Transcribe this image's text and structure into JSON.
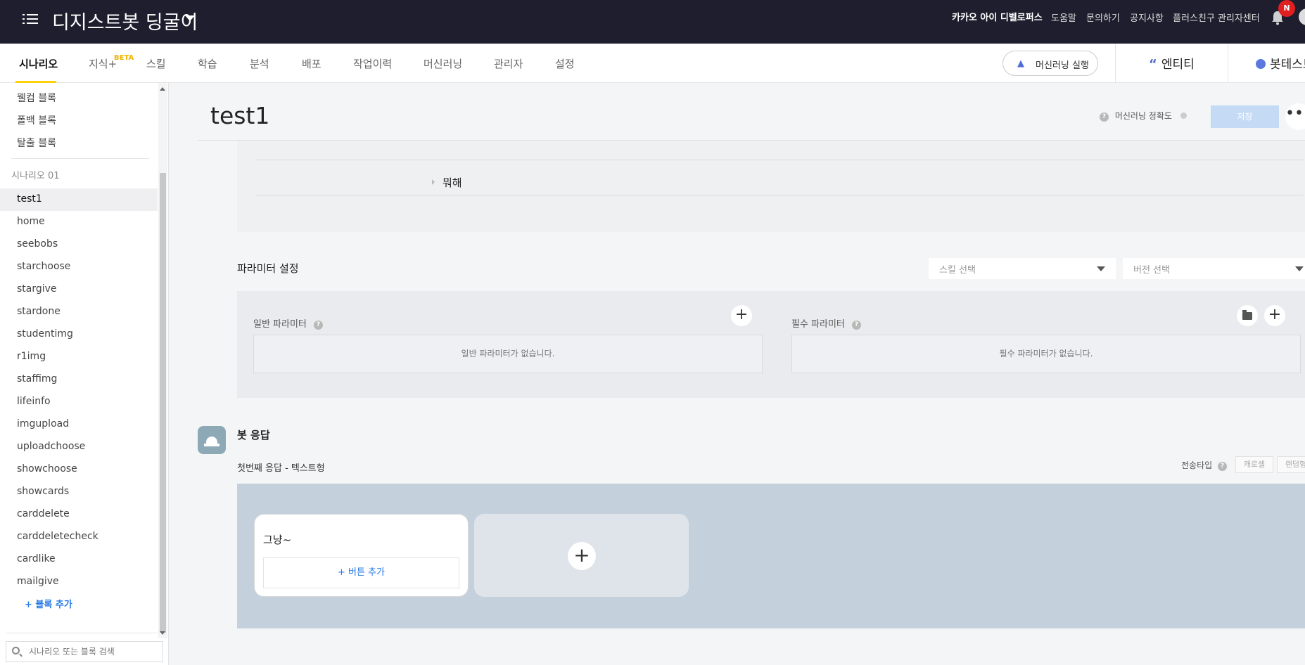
{
  "topbar": {
    "bot_name": "디지스트봇 딩굴이",
    "links": [
      "도움말",
      "문의하기",
      "공지사항",
      "플러스친구 관리자센터"
    ],
    "developers": "카카오 아이 디벨로퍼스",
    "notif_badge": "N"
  },
  "nav": {
    "tabs": [
      "시나리오",
      "지식+",
      "스킬",
      "학습",
      "분석",
      "배포",
      "작업이력",
      "머신러닝",
      "관리자",
      "설정"
    ],
    "beta": "BETA",
    "ml_run": "머신러닝 실행",
    "entity": "엔티티",
    "bot_test": "봇테스트"
  },
  "sidebar": {
    "system_blocks": [
      "웰컴 블록",
      "폴백 블록",
      "탈출 블록"
    ],
    "section": "시나리오 01",
    "blocks": [
      "test1",
      "home",
      "seebobs",
      "starchoose",
      "stargive",
      "stardone",
      "studentimg",
      "r1img",
      "staffimg",
      "lifeinfo",
      "imgupload",
      "uploadchoose",
      "showchoose",
      "showcards",
      "carddelete",
      "carddeletecheck",
      "cardlike",
      "mailgive"
    ],
    "add_block": "+ 블록 추가",
    "search_placeholder": "시나리오 또는 블록 검색"
  },
  "main": {
    "title": "test1",
    "ml_accuracy": "머신러닝 정확도",
    "save": "저장",
    "more": "•••",
    "utterance": "뭐해",
    "param_title": "파라미터 설정",
    "skill_select": "스킬 선택",
    "version_select": "버전 선택",
    "general_param": "일반 파라미터",
    "general_empty": "일반 파라미터가 없습니다.",
    "required_param": "필수 파라미터",
    "required_empty": "필수 파라미터가 없습니다.",
    "bot_response": "봇 응답",
    "first_response": "첫번째 응답 - 텍스트형",
    "send_type": "전송타입",
    "carousel": "캐로셀",
    "random": "랜덤형",
    "card_text": "그냥~",
    "add_button": "+ 버튼 추가"
  },
  "colors": {
    "topbar_bg": "#1e1e2e",
    "accent_yellow": "#fcd00b",
    "link_blue": "#2a7be4",
    "response_panel": "#c4d1dc"
  }
}
